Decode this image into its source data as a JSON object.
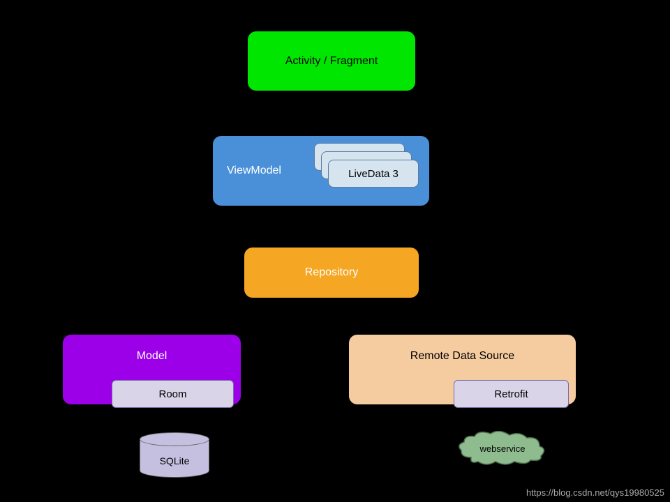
{
  "nodes": {
    "activity": "Activity / Fragment",
    "viewmodel": "ViewModel",
    "livedata": "LiveData 3",
    "repository": "Repository",
    "model": "Model",
    "room": "Room",
    "remote": "Remote Data Source",
    "retrofit": "Retrofit",
    "sqlite": "SQLite",
    "webservice": "webservice"
  },
  "watermark": "https://blog.csdn.net/qys19980525",
  "colors": {
    "activity": "#00E600",
    "viewmodel": "#4A90D9",
    "repository": "#F5A623",
    "model": "#9B00E8",
    "remote": "#F5CBA0",
    "subbox": "#D9D4E7",
    "livedata": "#D6E4F0",
    "sqlite": "#C5BFE0",
    "cloud": "#8FBC8F"
  }
}
